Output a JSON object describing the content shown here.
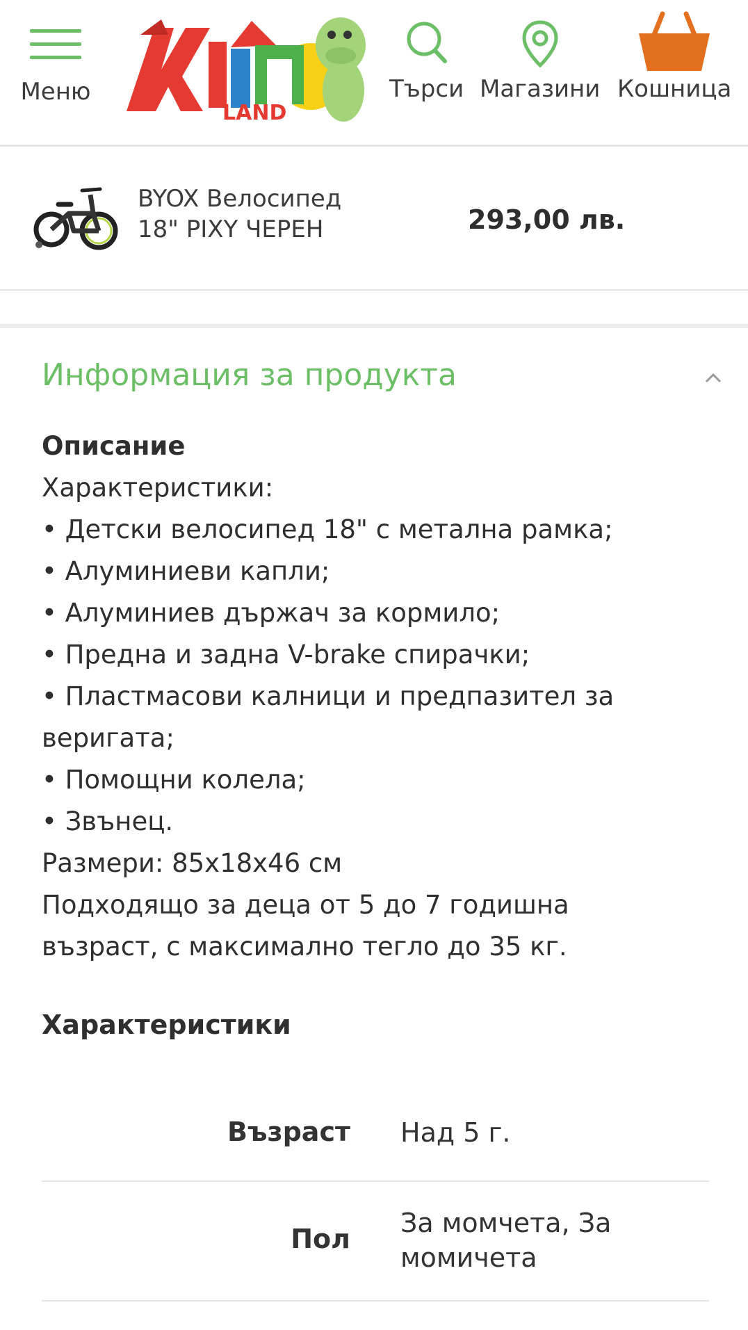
{
  "header": {
    "menu_label": "Меню",
    "search_label": "Търси",
    "stores_label": "Магазини",
    "cart_label": "Кошница",
    "logo_text": "ХИП",
    "logo_subtext": "LAND",
    "accent_color": "#6dbf67",
    "cart_color": "#e2701f"
  },
  "product": {
    "name_line1": "BYOX Велосипед",
    "name_line2": "18\" PIXY ЧЕРЕН",
    "price": "293,00 лв."
  },
  "info": {
    "title": "Информация за продукта",
    "description_heading": "Описание",
    "lines": [
      "Характеристики:",
      "• Детски велосипед 18\" с метална рамка;",
      "• Алуминиеви капли;",
      "• Алуминиев държач за кормило;",
      "• Предна и задна V-brake спирачки;",
      "• Пластмасови калници и предпазител за",
      "веригата;",
      "• Помощни колела;",
      "• Звънец.",
      "Размери: 85x18x46 см",
      "Подходящо за деца от 5 до 7 годишна",
      "възраст, с максимално тегло до 35 кг."
    ],
    "characteristics_heading": "Характеристики",
    "specs": [
      {
        "key": "Възраст",
        "value": "Над 5 г."
      },
      {
        "key": "Пол",
        "value": "За момчета, За момичета"
      }
    ]
  }
}
